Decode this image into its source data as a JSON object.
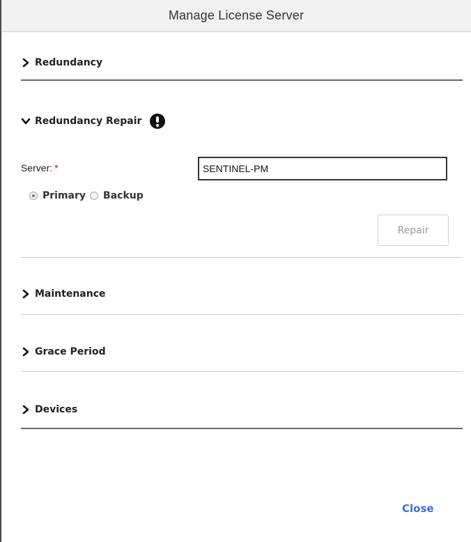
{
  "dialog": {
    "title": "Manage License Server",
    "close_label": "Close"
  },
  "sections": {
    "redundancy": {
      "label": "Redundancy",
      "expanded": false,
      "icon": "chevron-right-icon"
    },
    "redundancy_repair": {
      "label": "Redundancy Repair",
      "expanded": true,
      "icon": "chevron-down-icon",
      "alert_icon": "exclamation-circle-icon",
      "server_label": "Server:",
      "required_marker": "*",
      "server_value": "SENTINEL-PM",
      "radio_options": [
        {
          "label": "Primary",
          "checked": true
        },
        {
          "label": "Backup",
          "checked": false
        }
      ],
      "repair_label": "Repair"
    },
    "maintenance": {
      "label": "Maintenance",
      "expanded": false,
      "icon": "chevron-right-icon"
    },
    "grace_period": {
      "label": "Grace Period",
      "expanded": false,
      "icon": "chevron-right-icon"
    },
    "devices": {
      "label": "Devices",
      "expanded": false,
      "icon": "chevron-right-icon"
    }
  },
  "colors": {
    "link": "#3b6fd6",
    "required": "#d0021b",
    "title_bg": "#f1f1f1"
  }
}
